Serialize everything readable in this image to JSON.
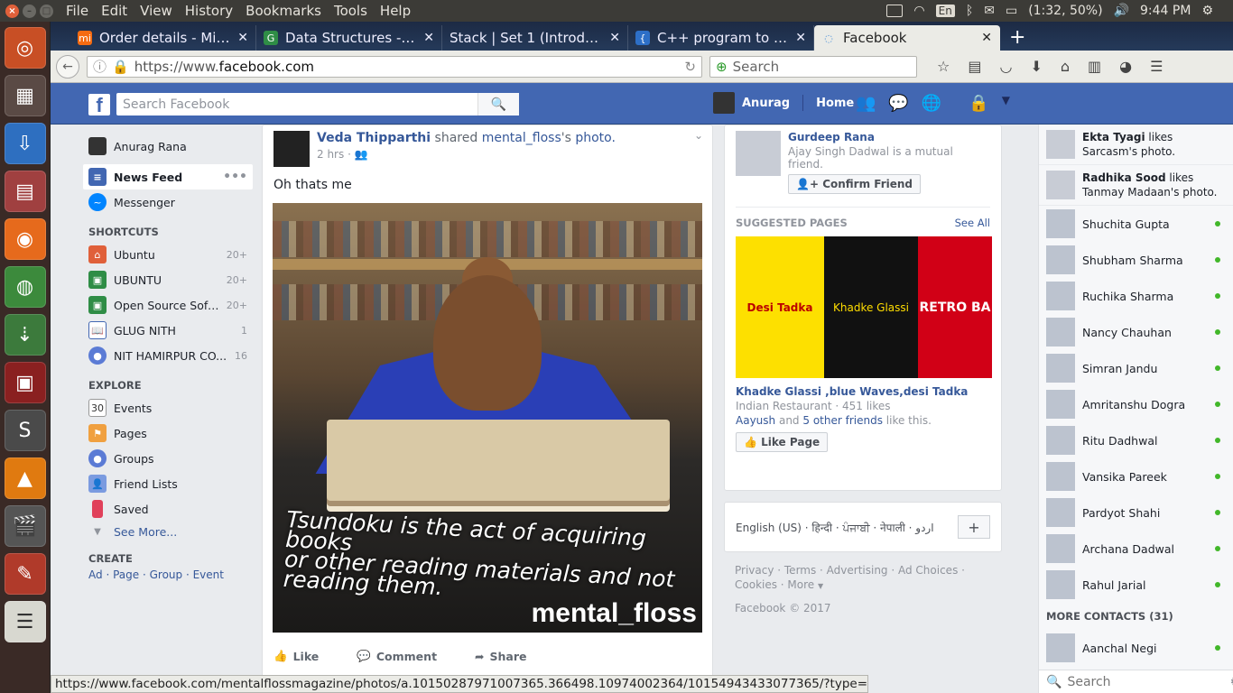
{
  "system": {
    "menu": [
      "File",
      "Edit",
      "View",
      "History",
      "Bookmarks",
      "Tools",
      "Help"
    ],
    "lang": "En",
    "battery": "(1:32, 50%)",
    "clock": "9:44 PM"
  },
  "browser": {
    "tabs": [
      {
        "title": "Order details - Mi In...",
        "icon": "mi-icon",
        "color": "#f56b12"
      },
      {
        "title": "Data Structures - Ge...",
        "icon": "gfg-icon",
        "color": "#2f8d46"
      },
      {
        "title": "Stack | Set 1 (Introducti...",
        "icon": "page-icon",
        "color": "#5a6b85"
      },
      {
        "title": "C++ program to imp...",
        "icon": "code-icon",
        "color": "#2d6fc7"
      },
      {
        "title": "Facebook",
        "icon": "loading-icon",
        "color": "#4267b2"
      }
    ],
    "url_prefix": "https://www.",
    "url_host": "facebook.com",
    "search_placeholder": "Search",
    "status_url": "https://www.facebook.com/mentalflossmagazine/photos/a.10150287971007365.366498.10974002364/10154943433077365/?type=3"
  },
  "fb": {
    "logo": "f",
    "search_placeholder": "Search Facebook",
    "user_short": "Anurag",
    "home": "Home",
    "left_nav": {
      "profile": "Anurag Rana",
      "news_feed": "News Feed",
      "messenger": "Messenger",
      "shortcuts_head": "SHORTCUTS",
      "shortcuts": [
        {
          "label": "Ubuntu",
          "count": "20+",
          "color": "#e0603a"
        },
        {
          "label": "UBUNTU",
          "count": "20+",
          "color": "#2f8d46"
        },
        {
          "label": "Open Source Softwa...",
          "count": "20+",
          "color": "#2f8d46"
        },
        {
          "label": "GLUG NITH",
          "count": "1",
          "color": "#4267b2"
        },
        {
          "label": "NIT HAMIRPUR CO...",
          "count": "16",
          "color": "#5b7bd5"
        }
      ],
      "explore_head": "EXPLORE",
      "explore": [
        {
          "label": "Events",
          "color": "#d5d9e0"
        },
        {
          "label": "Pages",
          "color": "#f0a040"
        },
        {
          "label": "Groups",
          "color": "#5b7bd5"
        },
        {
          "label": "Friend Lists",
          "color": "#7b9be0"
        },
        {
          "label": "Saved",
          "color": "#e0405a"
        }
      ],
      "see_more": "See More...",
      "create_head": "CREATE",
      "create_links": [
        "Ad",
        "Page",
        "Group",
        "Event"
      ]
    },
    "post": {
      "author": "Veda Thipparthi",
      "verb": "shared",
      "page": "mental_floss",
      "suffix": "'s",
      "object": "photo.",
      "time": "2 hrs",
      "text": "Oh thats me",
      "caption_line1": "Tsundoku is the act of acquiring books",
      "caption_line2": "or other reading materials and not",
      "caption_line3": "reading them.",
      "watermark": "mental_floss",
      "like": "Like",
      "comment": "Comment",
      "share": "Share"
    },
    "right": {
      "friend_request_name": "Gurdeep Rana",
      "friend_request_mutual": "Ajay Singh Dadwal is a mutual friend.",
      "confirm_friend": "Confirm Friend",
      "suggested_pages": "SUGGESTED PAGES",
      "see_all": "See All",
      "ad_text_a": "Desi Tadka",
      "ad_text_b": "Khadke Glassi",
      "ad_text_c": "RETRO BA",
      "page_name": "Khadke Glassi ,blue Waves,desi Tadka",
      "page_category": "Indian Restaurant · 451 likes",
      "friends_a": "Aayush",
      "friends_and": "and",
      "friends_b": "5 other friends",
      "friends_tail": "like this.",
      "like_page": "Like Page",
      "languages": "English (US) · हिन्दी · ਪੰਜਾਬੀ · नेपाली · اردو",
      "footer_line1": "Privacy · Terms · Advertising · Ad Choices · ",
      "footer_line2": "Cookies · More",
      "copyright": "Facebook © 2017"
    },
    "chat": {
      "ticker": [
        {
          "name": "Ekta Tyagi",
          "text": "likes Sarcasm's photo."
        },
        {
          "name": "Radhika Sood",
          "text": "likes Tanmay Madaan's photo."
        }
      ],
      "contacts": [
        "Shuchita Gupta",
        "Shubham Sharma",
        "Ruchika Sharma",
        "Nancy Chauhan",
        "Simran Jandu",
        "Amritanshu Dogra",
        "Ritu Dadhwal",
        "Vansika Pareek",
        "Pardyot Shahi",
        "Archana Dadwal",
        "Rahul Jarial"
      ],
      "more_contacts": "MORE CONTACTS (31)",
      "more_list": [
        "Aanchal Negi"
      ],
      "search_placeholder": "Search"
    }
  }
}
